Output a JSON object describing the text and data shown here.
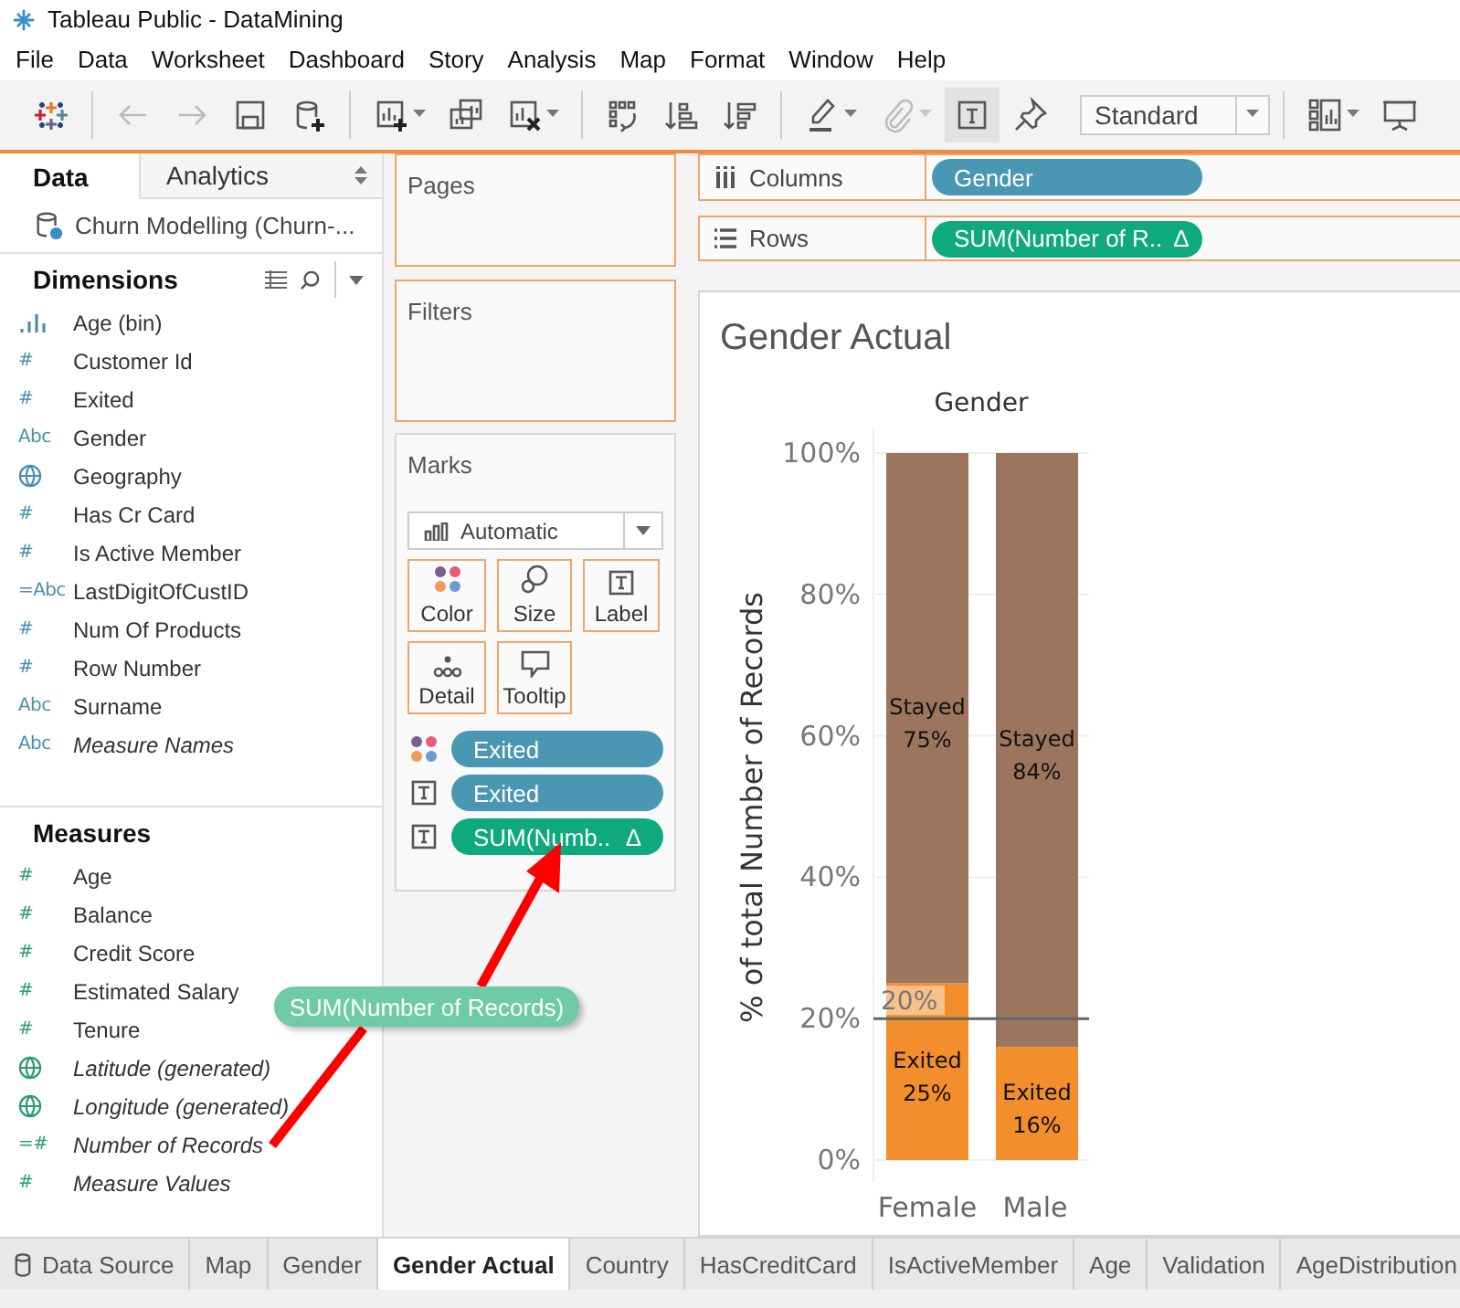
{
  "window": {
    "title": "Tableau Public - DataMining"
  },
  "menu": [
    "File",
    "Data",
    "Worksheet",
    "Dashboard",
    "Story",
    "Analysis",
    "Map",
    "Format",
    "Window",
    "Help"
  ],
  "toolbar": {
    "groups": [
      [
        {
          "kind": "logo",
          "disabled": false,
          "on": false,
          "menu": false
        }
      ],
      [
        {
          "kind": "back",
          "disabled": true,
          "on": false,
          "menu": false
        },
        {
          "kind": "forward",
          "disabled": true,
          "on": false,
          "menu": false
        },
        {
          "kind": "save",
          "disabled": false,
          "on": false,
          "menu": false
        },
        {
          "kind": "add-datasource",
          "disabled": false,
          "on": false,
          "menu": false
        }
      ],
      [
        {
          "kind": "new-sheet",
          "disabled": false,
          "on": false,
          "menu": true
        },
        {
          "kind": "duplicate",
          "disabled": false,
          "on": false,
          "menu": false
        },
        {
          "kind": "clear",
          "disabled": false,
          "on": false,
          "menu": true
        }
      ],
      [
        {
          "kind": "swap",
          "disabled": false,
          "on": false,
          "menu": false
        },
        {
          "kind": "sort-asc",
          "disabled": false,
          "on": false,
          "menu": false
        },
        {
          "kind": "sort-desc",
          "disabled": false,
          "on": false,
          "menu": false
        }
      ],
      [
        {
          "kind": "highlight",
          "disabled": false,
          "on": false,
          "menu": true
        },
        {
          "kind": "group",
          "disabled": true,
          "on": false,
          "menu": true
        },
        {
          "kind": "labels",
          "disabled": false,
          "on": true,
          "menu": false
        },
        {
          "kind": "pin",
          "disabled": false,
          "on": false,
          "menu": false
        },
        {
          "kind": "fit",
          "value": "Standard",
          "disabled": false,
          "on": false,
          "menu": true
        }
      ],
      [
        {
          "kind": "show-me",
          "disabled": false,
          "on": false,
          "menu": true
        },
        {
          "kind": "present",
          "disabled": false,
          "on": false,
          "menu": false
        }
      ]
    ]
  },
  "data_pane": {
    "tabs": [
      {
        "label": "Data",
        "selected": true
      },
      {
        "label": "Analytics",
        "selected": false
      }
    ],
    "datasource": "Churn Modelling (Churn-...",
    "dimensions": {
      "title": "Dimensions",
      "fields": [
        {
          "name": "Age (bin)",
          "kind": "bin",
          "generated": false
        },
        {
          "name": "Customer Id",
          "kind": "type",
          "type_icon": "#",
          "generated": false
        },
        {
          "name": "Exited",
          "kind": "type",
          "type_icon": "#",
          "generated": false
        },
        {
          "name": "Gender",
          "kind": "type",
          "type_icon": "Abc",
          "generated": false
        },
        {
          "name": "Geography",
          "kind": "geo",
          "generated": false
        },
        {
          "name": "Has Cr Card",
          "kind": "type",
          "type_icon": "#",
          "generated": false
        },
        {
          "name": "Is Active Member",
          "kind": "type",
          "type_icon": "#",
          "generated": false
        },
        {
          "name": "LastDigitOfCustID",
          "kind": "type",
          "type_icon": "=Abc",
          "generated": false
        },
        {
          "name": "Num Of Products",
          "kind": "type",
          "type_icon": "#",
          "generated": false
        },
        {
          "name": "Row Number",
          "kind": "type",
          "type_icon": "#",
          "generated": false
        },
        {
          "name": "Surname",
          "kind": "type",
          "type_icon": "Abc",
          "generated": false
        },
        {
          "name": "Measure Names",
          "kind": "type",
          "type_icon": "Abc",
          "generated": true
        }
      ]
    },
    "measures": {
      "title": "Measures",
      "fields": [
        {
          "name": "Age",
          "kind": "type",
          "type_icon": "#",
          "generated": false
        },
        {
          "name": "Balance",
          "kind": "type",
          "type_icon": "#",
          "generated": false
        },
        {
          "name": "Credit Score",
          "kind": "type",
          "type_icon": "#",
          "generated": false
        },
        {
          "name": "Estimated Salary",
          "kind": "type",
          "type_icon": "#",
          "generated": false
        },
        {
          "name": "Tenure",
          "kind": "type",
          "type_icon": "#",
          "generated": false
        },
        {
          "name": "Latitude (generated)",
          "kind": "geo",
          "generated": true
        },
        {
          "name": "Longitude (generated)",
          "kind": "geo",
          "generated": true
        },
        {
          "name": "Number of Records",
          "kind": "type",
          "type_icon": "=#",
          "generated": true
        },
        {
          "name": "Measure Values",
          "kind": "type",
          "type_icon": "#",
          "generated": true
        }
      ]
    }
  },
  "pages": {
    "title": "Pages"
  },
  "filters": {
    "title": "Filters"
  },
  "marks": {
    "title": "Marks",
    "mark_type": "Automatic",
    "cards": [
      {
        "label": "Color",
        "kind": "color"
      },
      {
        "label": "Size",
        "kind": "size"
      },
      {
        "label": "Label",
        "kind": "label"
      },
      {
        "label": "Detail",
        "kind": "detail"
      },
      {
        "label": "Tooltip",
        "kind": "tooltip"
      }
    ],
    "pills": [
      {
        "kind": "color",
        "label": "Exited",
        "continuous": false
      },
      {
        "kind": "label",
        "label": "Exited",
        "continuous": false
      },
      {
        "kind": "label",
        "label": "SUM(Numb..",
        "continuous": true,
        "calc_icon": "Δ"
      }
    ]
  },
  "shelves": [
    {
      "kind": "columns",
      "label": "Columns",
      "pills": [
        {
          "label": "Gender",
          "continuous": false
        }
      ]
    },
    {
      "kind": "rows",
      "label": "Rows",
      "pills": [
        {
          "label": "SUM(Number of R..",
          "continuous": true,
          "calc_icon": "Δ"
        }
      ]
    }
  ],
  "viz": {
    "chart_data": {
      "type": "bar",
      "stacked": true,
      "title": "Gender Actual",
      "xlabel": "Gender",
      "ylabel": "% of total Number of Records",
      "categories": [
        "Female",
        "Male"
      ],
      "series": [
        {
          "name": "Exited",
          "color": "#f28e2b",
          "values": [
            25,
            16
          ]
        },
        {
          "name": "Stayed",
          "color": "#9c755f",
          "values": [
            75,
            84
          ]
        }
      ],
      "ylim": [
        0,
        100
      ],
      "yticks": [
        {
          "value": 0,
          "label": "0%"
        },
        {
          "value": 20,
          "label": "20%"
        },
        {
          "value": 40,
          "label": "40%"
        },
        {
          "value": 60,
          "label": "60%"
        },
        {
          "value": 80,
          "label": "80%"
        },
        {
          "value": 100,
          "label": "100%"
        }
      ],
      "value_labels": [
        [
          "25%",
          "16%"
        ],
        [
          "75%",
          "84%"
        ]
      ],
      "grid": true,
      "ref_lines": [
        {
          "axis": "y",
          "value": 20,
          "label": "20%"
        }
      ]
    }
  },
  "drag_pill": {
    "label": "SUM(Number of Records)"
  },
  "sheet_tabs": [
    {
      "label": "Data Source",
      "kind": "datasource",
      "selected": false
    },
    {
      "label": "Map",
      "kind": "sheet",
      "selected": false
    },
    {
      "label": "Gender",
      "kind": "sheet",
      "selected": false
    },
    {
      "label": "Gender Actual",
      "kind": "sheet",
      "selected": true
    },
    {
      "label": "Country",
      "kind": "sheet",
      "selected": false
    },
    {
      "label": "HasCreditCard",
      "kind": "sheet",
      "selected": false
    },
    {
      "label": "IsActiveMember",
      "kind": "sheet",
      "selected": false
    },
    {
      "label": "Age",
      "kind": "sheet",
      "selected": false
    },
    {
      "label": "Validation",
      "kind": "sheet",
      "selected": false
    },
    {
      "label": "AgeDistribution",
      "kind": "sheet",
      "selected": false
    }
  ]
}
